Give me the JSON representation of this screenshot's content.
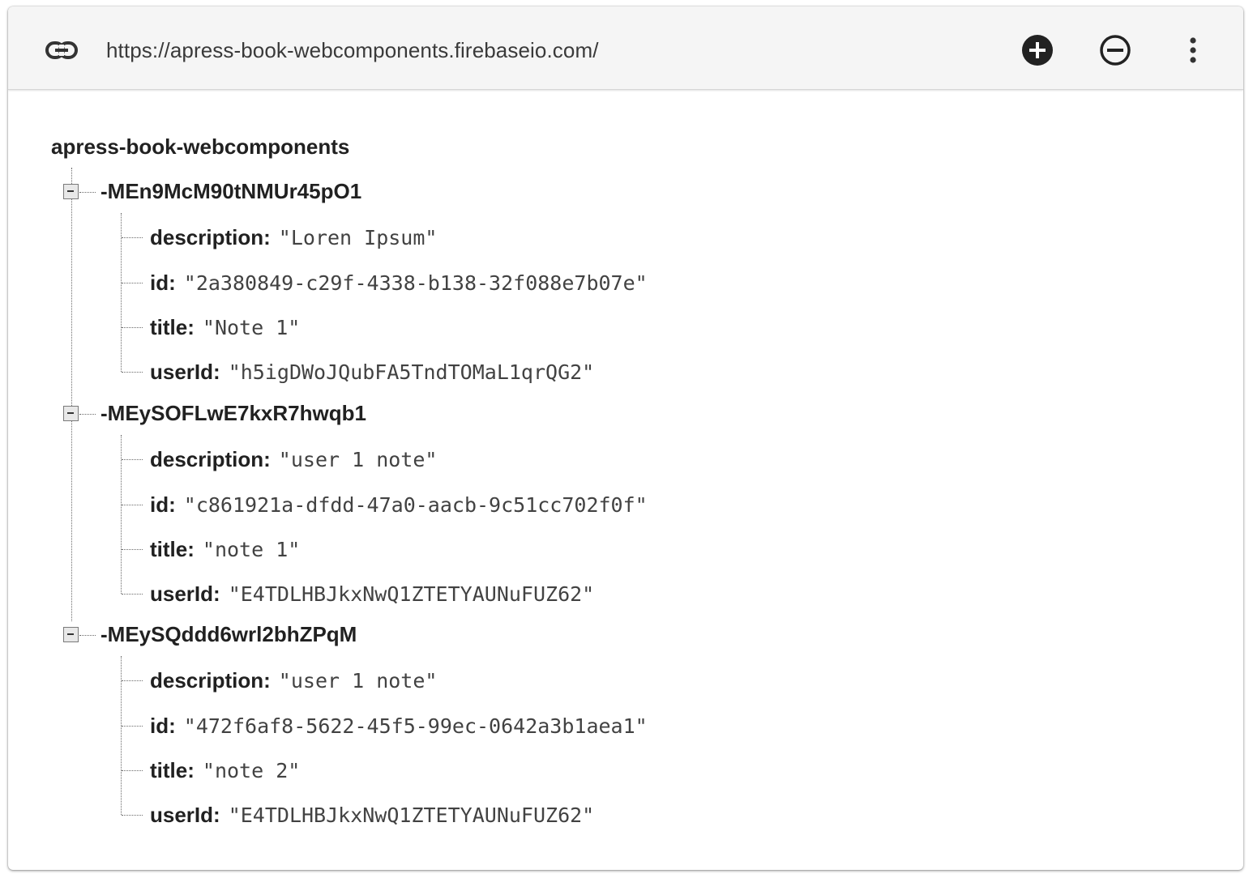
{
  "toolbar": {
    "url": "https://apress-book-webcomponents.firebaseio.com/",
    "icons": [
      "link-icon",
      "add-circle-icon",
      "remove-circle-outline-icon",
      "more-vert-icon"
    ]
  },
  "tree": {
    "root": "apress-book-webcomponents",
    "nodes": [
      {
        "key": "-MEn9McM90tNMUr45pO1",
        "fields": [
          {
            "key": "description:",
            "value": "\"Loren Ipsum\""
          },
          {
            "key": "id:",
            "value": "\"2a380849-c29f-4338-b138-32f088e7b07e\""
          },
          {
            "key": "title:",
            "value": "\"Note 1\""
          },
          {
            "key": "userId:",
            "value": "\"h5igDWoJQubFA5TndTOMaL1qrQG2\""
          }
        ]
      },
      {
        "key": "-MEySOFLwE7kxR7hwqb1",
        "fields": [
          {
            "key": "description:",
            "value": "\"user 1 note\""
          },
          {
            "key": "id:",
            "value": "\"c861921a-dfdd-47a0-aacb-9c51cc702f0f\""
          },
          {
            "key": "title:",
            "value": "\"note 1\""
          },
          {
            "key": "userId:",
            "value": "\"E4TDLHBJkxNwQ1ZTETYAUNuFUZ62\""
          }
        ]
      },
      {
        "key": "-MEySQddd6wrl2bhZPqM",
        "fields": [
          {
            "key": "description:",
            "value": "\"user 1 note\""
          },
          {
            "key": "id:",
            "value": "\"472f6af8-5622-45f5-99ec-0642a3b1aea1\""
          },
          {
            "key": "title:",
            "value": "\"note 2\""
          },
          {
            "key": "userId:",
            "value": "\"E4TDLHBJkxNwQ1ZTETYAUNuFUZ62\""
          }
        ]
      }
    ]
  }
}
